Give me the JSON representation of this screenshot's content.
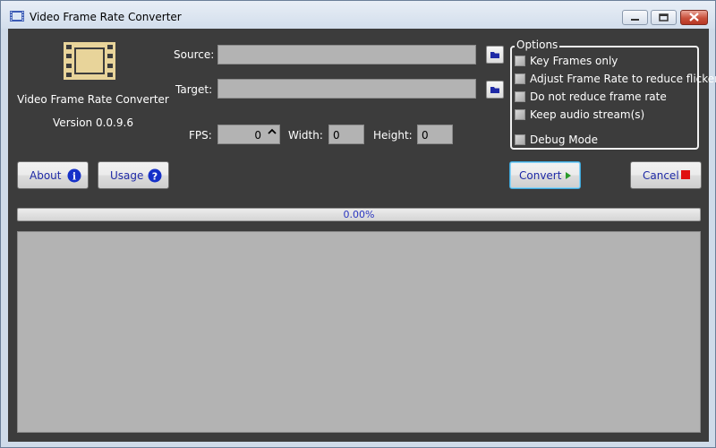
{
  "window": {
    "title": "Video Frame Rate Converter",
    "icon": "film-strip-icon",
    "controls": [
      "minimize-icon",
      "maximize-icon",
      "close-icon"
    ]
  },
  "app": {
    "name": "Video Frame Rate Converter",
    "version": "Version 0.0.9.6",
    "logo": "film-strip-icon"
  },
  "source": {
    "label": "Source:",
    "value": ""
  },
  "target": {
    "label": "Target:",
    "value": ""
  },
  "fps": {
    "label": "FPS:",
    "value": "0"
  },
  "width": {
    "label": "Width:",
    "value": "0"
  },
  "height": {
    "label": "Height:",
    "value": "0"
  },
  "options": {
    "legend": "Options",
    "items": [
      {
        "label": "Key Frames only",
        "checked": false
      },
      {
        "label": "Adjust Frame Rate to reduce flicker",
        "checked": false
      },
      {
        "label": "Do not reduce frame rate",
        "checked": false
      },
      {
        "label": "Keep audio stream(s)",
        "checked": false
      },
      {
        "label": "Debug Mode",
        "checked": false
      }
    ]
  },
  "buttons": {
    "about": "About",
    "usage": "Usage",
    "convert": "Convert",
    "cancel": "Cancel"
  },
  "progress": {
    "text": "0.00%",
    "value": 0
  },
  "colors": {
    "background": "#3c3c3c",
    "field": "#b3b3b3",
    "accent_blue": "#1f2aa6",
    "convert_border": "#3fa9dc",
    "logo": "#e8d49a",
    "cancel_icon": "#e01010",
    "convert_icon": "#2a9a2a"
  }
}
